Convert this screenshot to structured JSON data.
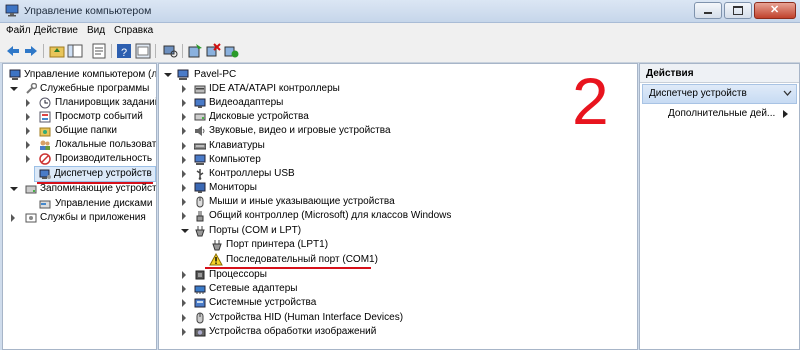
{
  "window": {
    "title": "Управление компьютером"
  },
  "menu": {
    "items": [
      "Файл",
      "Действие",
      "Вид",
      "Справка"
    ]
  },
  "left_tree": {
    "items": [
      "Управление компьютером (л",
      "Служебные программы",
      "Планировщик заданий",
      "Просмотр событий",
      "Общие папки",
      "Локальные пользовате",
      "Производительность",
      "Диспетчер устройств",
      "Запоминающие устройст",
      "Управление дисками",
      "Службы и приложения"
    ]
  },
  "device_tree": {
    "root": "Pavel-PC",
    "items": [
      "IDE ATA/ATAPI контроллеры",
      "Видеоадаптеры",
      "Дисковые устройства",
      "Звуковые, видео и игровые устройства",
      "Клавиатуры",
      "Компьютер",
      "Контроллеры USB",
      "Мониторы",
      "Мыши и иные указывающие устройства",
      "Общий контроллер (Microsoft) для классов Windows",
      "Порты (COM и LPT)",
      "Порт принтера (LPT1)",
      "Последовательный порт (COM1)",
      "Процессоры",
      "Сетевые адаптеры",
      "Системные устройства",
      "Устройства HID (Human Interface Devices)",
      "Устройства обработки изображений"
    ],
    "annotation": "2"
  },
  "actions": {
    "header": "Действия",
    "section": "Диспетчер устройств",
    "more": "Дополнительные дей..."
  },
  "colors": {
    "annotation_red": "#e8141e",
    "selection": "#dce9f8",
    "title_bg": "#c6d6ea"
  }
}
